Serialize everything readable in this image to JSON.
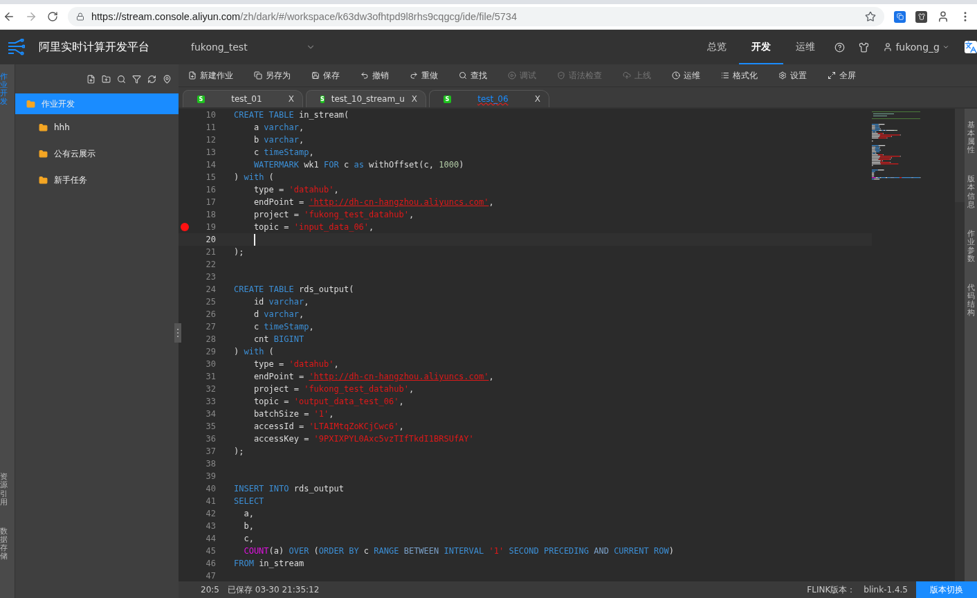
{
  "browser": {
    "url_host": "https://stream.console.aliyun.com",
    "url_path": "/zh/dark/#/workspace/k63dw3ofhtpd9l8rhs9cqgcg/ide/file/5734"
  },
  "header": {
    "title": "阿里实时计算开发平台",
    "project": "fukong_test",
    "nav": [
      {
        "label": "总览",
        "selected": false
      },
      {
        "label": "开发",
        "selected": true
      },
      {
        "label": "运维",
        "selected": false
      }
    ],
    "user": "fukong_g"
  },
  "left_rail": [
    {
      "label": "作业开发",
      "selected": true
    },
    {
      "label": "资源引用",
      "selected": false
    },
    {
      "label": "数据存储",
      "selected": false
    }
  ],
  "tree": [
    {
      "label": "作业开发",
      "selected": true,
      "children": [
        {
          "label": "hhh",
          "selected": false
        },
        {
          "label": "公有云展示",
          "selected": false
        },
        {
          "label": "新手任务",
          "selected": false
        }
      ]
    }
  ],
  "toolbar": [
    {
      "kind": "new",
      "label": "新建作业",
      "disabled": false
    },
    {
      "kind": "copy",
      "label": "另存为",
      "disabled": false
    },
    {
      "kind": "save",
      "label": "保存",
      "disabled": false
    },
    {
      "kind": "undo",
      "label": "撤销",
      "disabled": false
    },
    {
      "kind": "redo",
      "label": "重做",
      "disabled": false
    },
    {
      "kind": "search",
      "label": "查找",
      "disabled": false
    },
    {
      "kind": "debug",
      "label": "调试",
      "disabled": true
    },
    {
      "kind": "check",
      "label": "语法检查",
      "disabled": true
    },
    {
      "kind": "upload",
      "label": "上线",
      "disabled": true
    },
    {
      "kind": "ops",
      "label": "运维",
      "disabled": false
    },
    {
      "kind": "format",
      "label": "格式化",
      "disabled": false
    },
    {
      "kind": "settings",
      "label": "设置",
      "disabled": false
    },
    {
      "kind": "fullscreen",
      "label": "全屏",
      "disabled": false
    }
  ],
  "tabs": [
    {
      "badge": "S",
      "label": "test_01",
      "close": "X",
      "selected": false
    },
    {
      "badge": "S",
      "label": "test_10_stream_u",
      "close": "X",
      "selected": false
    },
    {
      "badge": "S",
      "label": "test_06",
      "close": "X",
      "selected": true
    }
  ],
  "code": [
    {
      "n": "10",
      "tokens": [
        {
          "text": "CREATE TABLE",
          "kind": "kw"
        },
        {
          "text": " in_stream(",
          "kind": "plain"
        }
      ]
    },
    {
      "n": "11",
      "tokens": [
        {
          "text": "    a ",
          "kind": "plain"
        },
        {
          "text": "varchar",
          "kind": "kw"
        },
        {
          "text": ",",
          "kind": "plain"
        }
      ]
    },
    {
      "n": "12",
      "tokens": [
        {
          "text": "    b ",
          "kind": "plain"
        },
        {
          "text": "varchar",
          "kind": "kw"
        },
        {
          "text": ",",
          "kind": "plain"
        }
      ]
    },
    {
      "n": "13",
      "tokens": [
        {
          "text": "    c ",
          "kind": "plain"
        },
        {
          "text": "timeStamp",
          "kind": "kw"
        },
        {
          "text": ",",
          "kind": "plain"
        }
      ]
    },
    {
      "n": "14",
      "tokens": [
        {
          "text": "    WATERMARK",
          "kind": "kw"
        },
        {
          "text": " wk1 ",
          "kind": "plain"
        },
        {
          "text": "FOR",
          "kind": "kw"
        },
        {
          "text": " c ",
          "kind": "plain"
        },
        {
          "text": "as",
          "kind": "kw"
        },
        {
          "text": " withOffset(c, ",
          "kind": "plain"
        },
        {
          "text": "1000",
          "kind": "num"
        },
        {
          "text": ")",
          "kind": "plain"
        }
      ]
    },
    {
      "n": "15",
      "tokens": [
        {
          "text": ") ",
          "kind": "plain"
        },
        {
          "text": "with",
          "kind": "kw"
        },
        {
          "text": " (",
          "kind": "plain"
        }
      ]
    },
    {
      "n": "16",
      "tokens": [
        {
          "text": "    type = ",
          "kind": "plain"
        },
        {
          "text": "'datahub'",
          "kind": "str"
        },
        {
          "text": ",",
          "kind": "plain"
        }
      ]
    },
    {
      "n": "17",
      "tokens": [
        {
          "text": "    endPoint = ",
          "kind": "plain"
        },
        {
          "text": "'http://dh-cn-hangzhou.aliyuncs.com'",
          "kind": "link"
        },
        {
          "text": ",",
          "kind": "plain"
        }
      ]
    },
    {
      "n": "18",
      "tokens": [
        {
          "text": "    project = ",
          "kind": "plain"
        },
        {
          "text": "'fukong_test_datahub'",
          "kind": "str"
        },
        {
          "text": ",",
          "kind": "plain"
        }
      ]
    },
    {
      "n": "19",
      "error": true,
      "tokens": [
        {
          "text": "    topic = ",
          "kind": "plain"
        },
        {
          "text": "'input_data_06'",
          "kind": "str"
        },
        {
          "text": ",",
          "kind": "plain"
        }
      ]
    },
    {
      "n": "20",
      "current": true
    },
    {
      "n": "21",
      "tokens": [
        {
          "text": ");",
          "kind": "plain"
        }
      ]
    },
    {
      "n": "22"
    },
    {
      "n": "23"
    },
    {
      "n": "24",
      "tokens": [
        {
          "text": "CREATE TABLE",
          "kind": "kw"
        },
        {
          "text": " rds_output(",
          "kind": "plain"
        }
      ]
    },
    {
      "n": "25",
      "tokens": [
        {
          "text": "    id ",
          "kind": "plain"
        },
        {
          "text": "varchar",
          "kind": "kw"
        },
        {
          "text": ",",
          "kind": "plain"
        }
      ]
    },
    {
      "n": "26",
      "tokens": [
        {
          "text": "    d ",
          "kind": "plain"
        },
        {
          "text": "varchar",
          "kind": "kw"
        },
        {
          "text": ",",
          "kind": "plain"
        }
      ]
    },
    {
      "n": "27",
      "tokens": [
        {
          "text": "    c ",
          "kind": "plain"
        },
        {
          "text": "timeStamp",
          "kind": "kw"
        },
        {
          "text": ",",
          "kind": "plain"
        }
      ]
    },
    {
      "n": "28",
      "tokens": [
        {
          "text": "    cnt ",
          "kind": "plain"
        },
        {
          "text": "BIGINT",
          "kind": "kw"
        }
      ]
    },
    {
      "n": "29",
      "tokens": [
        {
          "text": ") ",
          "kind": "plain"
        },
        {
          "text": "with",
          "kind": "kw"
        },
        {
          "text": " (",
          "kind": "plain"
        }
      ]
    },
    {
      "n": "30",
      "tokens": [
        {
          "text": "    type = ",
          "kind": "plain"
        },
        {
          "text": "'datahub'",
          "kind": "str"
        },
        {
          "text": ",",
          "kind": "plain"
        }
      ]
    },
    {
      "n": "31",
      "tokens": [
        {
          "text": "    endPoint = ",
          "kind": "plain"
        },
        {
          "text": "'http://dh-cn-hangzhou.aliyuncs.com'",
          "kind": "link"
        },
        {
          "text": ",",
          "kind": "plain"
        }
      ]
    },
    {
      "n": "32",
      "tokens": [
        {
          "text": "    project = ",
          "kind": "plain"
        },
        {
          "text": "'fukong_test_datahub'",
          "kind": "str"
        },
        {
          "text": ",",
          "kind": "plain"
        }
      ]
    },
    {
      "n": "33",
      "tokens": [
        {
          "text": "    topic = ",
          "kind": "plain"
        },
        {
          "text": "'output_data_test_06'",
          "kind": "str"
        },
        {
          "text": ",",
          "kind": "plain"
        }
      ]
    },
    {
      "n": "34",
      "tokens": [
        {
          "text": "    batchSize = ",
          "kind": "plain"
        },
        {
          "text": "'1'",
          "kind": "str"
        },
        {
          "text": ",",
          "kind": "plain"
        }
      ]
    },
    {
      "n": "35",
      "tokens": [
        {
          "text": "    accessId = ",
          "kind": "plain"
        },
        {
          "text": "'LTAIMtqZoKCjCwc6'",
          "kind": "str"
        },
        {
          "text": ",",
          "kind": "plain"
        }
      ]
    },
    {
      "n": "36",
      "tokens": [
        {
          "text": "    accessKey = ",
          "kind": "plain"
        },
        {
          "text": "'9PXIXPYL0Axc5vzTIfTkdI1BRSUfAY'",
          "kind": "str"
        }
      ]
    },
    {
      "n": "37",
      "tokens": [
        {
          "text": ");",
          "kind": "plain"
        }
      ]
    },
    {
      "n": "38"
    },
    {
      "n": "39"
    },
    {
      "n": "40",
      "tokens": [
        {
          "text": "INSERT INTO",
          "kind": "kw"
        },
        {
          "text": " rds_output",
          "kind": "plain"
        }
      ]
    },
    {
      "n": "41",
      "tokens": [
        {
          "text": "SELECT",
          "kind": "kw"
        }
      ]
    },
    {
      "n": "42",
      "tokens": [
        {
          "text": "  a,",
          "kind": "plain"
        }
      ]
    },
    {
      "n": "43",
      "tokens": [
        {
          "text": "  b,",
          "kind": "plain"
        }
      ]
    },
    {
      "n": "44",
      "tokens": [
        {
          "text": "  c,",
          "kind": "plain"
        }
      ]
    },
    {
      "n": "45",
      "tokens": [
        {
          "text": "  COUNT",
          "kind": "fn"
        },
        {
          "text": "(a) ",
          "kind": "plain"
        },
        {
          "text": "OVER",
          "kind": "kw"
        },
        {
          "text": " (",
          "kind": "plain"
        },
        {
          "text": "ORDER BY",
          "kind": "kw"
        },
        {
          "text": " c ",
          "kind": "plain"
        },
        {
          "text": "RANGE",
          "kind": "kw"
        },
        {
          "text": " BETWEEN",
          "kind": "kw2"
        },
        {
          "text": " INTERVAL",
          "kind": "kw"
        },
        {
          "text": " '1'",
          "kind": "str"
        },
        {
          "text": " SECOND PRECEDING",
          "kind": "kw"
        },
        {
          "text": " AND",
          "kind": "kw2"
        },
        {
          "text": " CURRENT ROW",
          "kind": "kw"
        },
        {
          "text": ")",
          "kind": "plain"
        }
      ]
    },
    {
      "n": "46",
      "tokens": [
        {
          "text": "FROM",
          "kind": "kw"
        },
        {
          "text": " in_stream",
          "kind": "plain"
        }
      ]
    },
    {
      "n": "47"
    }
  ],
  "right_rail": [
    "基本属性",
    "版本信息",
    "作业参数",
    "代码结构"
  ],
  "status": {
    "cursor": "20:5",
    "saved": "已保存 03-30 21:35:12",
    "engine_label": "FLINK版本：",
    "engine": "blink-1.4.5",
    "switch_button": "版本切换"
  }
}
